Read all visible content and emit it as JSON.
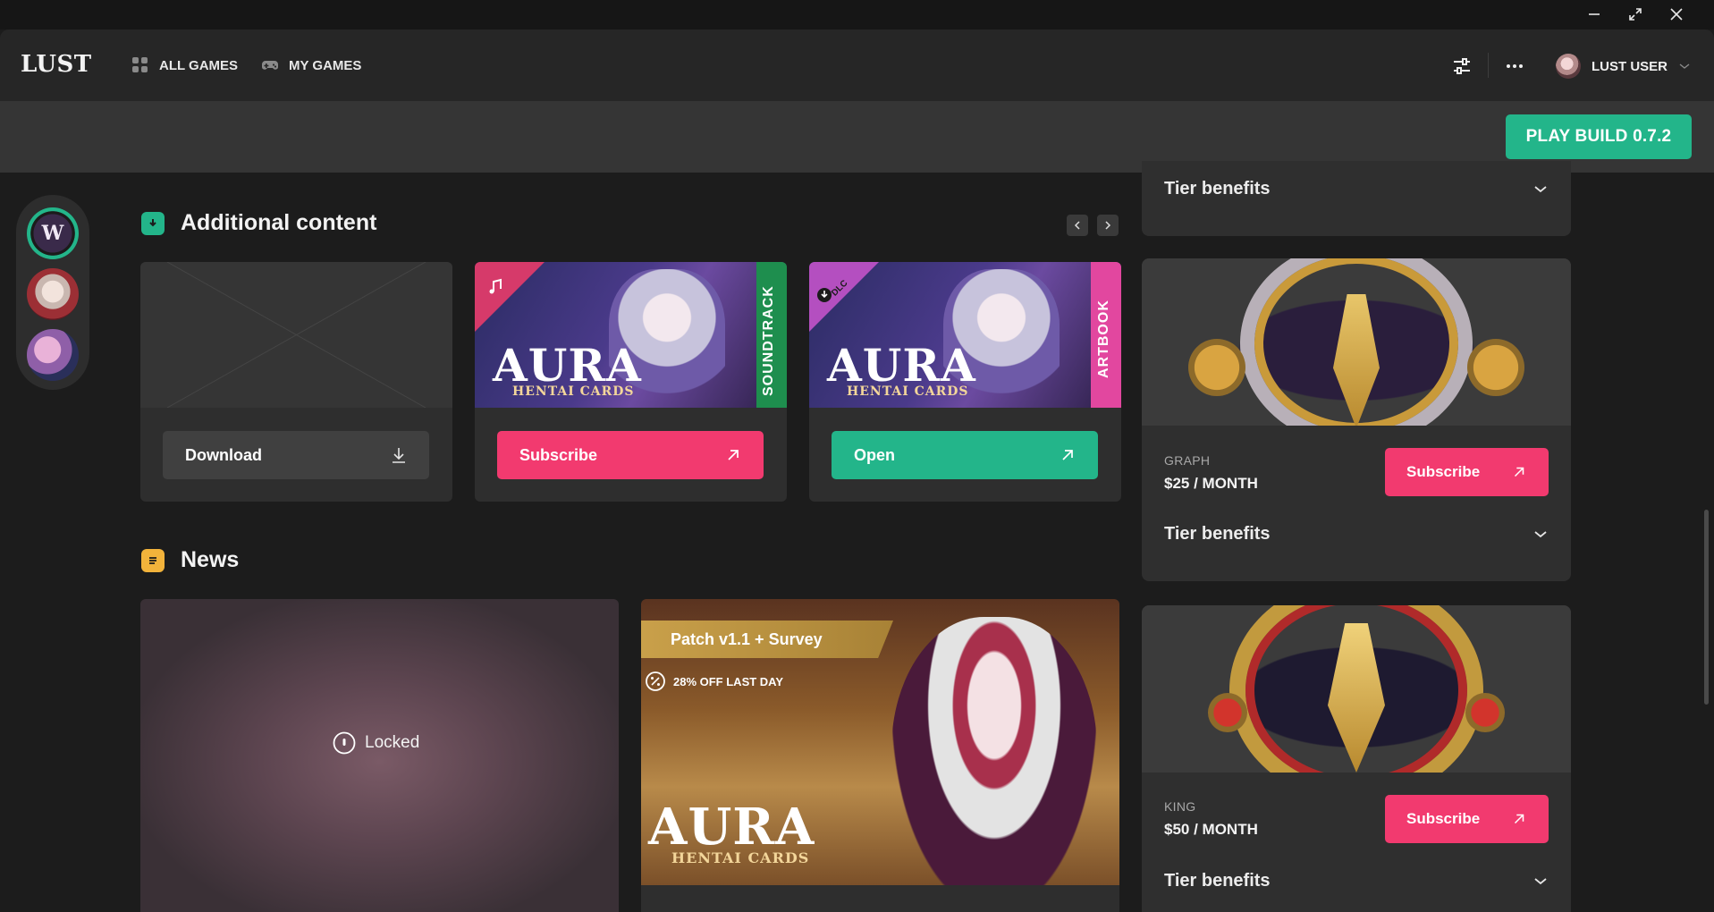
{
  "window": {
    "minimize_icon": "minimize-icon",
    "maximize_icon": "maximize-icon",
    "close_icon": "close-icon"
  },
  "header": {
    "logo": "LUST",
    "nav": [
      {
        "label": "ALL GAMES",
        "icon": "grid-icon"
      },
      {
        "label": "MY GAMES",
        "icon": "gamepad-icon"
      }
    ],
    "user_name": "LUST USER"
  },
  "toolbar": {
    "play_label": "PLAY BUILD 0.7.2"
  },
  "additional_content": {
    "title": "Additional content",
    "items": [
      {
        "button": "Download",
        "button_icon": "download-icon"
      },
      {
        "logo": "AURA",
        "logo_sub": "HENTAI CARDS",
        "side_tag": "SOUNDTRACK",
        "button": "Subscribe",
        "button_icon": "arrow-up-right-icon"
      },
      {
        "logo": "AURA",
        "logo_sub": "HENTAI CARDS",
        "corner_tag": "DLC",
        "side_tag": "ARTBOOK",
        "button": "Open",
        "button_icon": "arrow-up-right-icon"
      }
    ]
  },
  "news": {
    "title": "News",
    "items": [
      {
        "locked_label": "Locked"
      },
      {
        "banner": "Patch v1.1 + Survey",
        "promo": "28% OFF LAST DAY",
        "logo": "AURA",
        "logo_sub": "HENTAI CARDS"
      }
    ]
  },
  "tiers": {
    "top_benefits": "Tier benefits",
    "items": [
      {
        "name": "GRAPH",
        "price": "$25 / MONTH",
        "button": "Subscribe",
        "benefits": "Tier benefits"
      },
      {
        "name": "KING",
        "price": "$50 / MONTH",
        "button": "Subscribe",
        "benefits": "Tier benefits"
      }
    ]
  },
  "colors": {
    "accent_green": "#23b58a",
    "accent_pink": "#f23a6f",
    "panel": "#2e2e2e",
    "background": "#1c1c1c"
  }
}
